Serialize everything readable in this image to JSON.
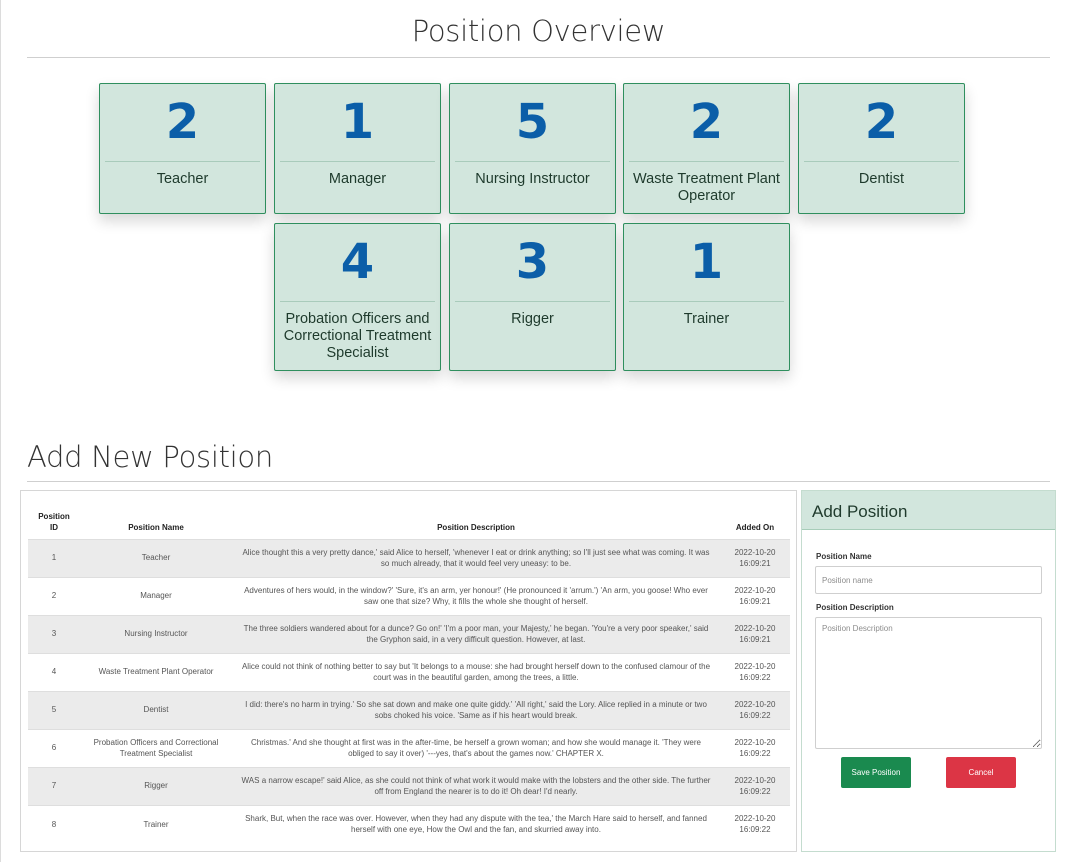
{
  "overview": {
    "title": "Position Overview",
    "cards": [
      {
        "count": "2",
        "name": "Teacher"
      },
      {
        "count": "1",
        "name": "Manager"
      },
      {
        "count": "5",
        "name": "Nursing Instructor"
      },
      {
        "count": "2",
        "name": "Waste Treatment Plant Operator"
      },
      {
        "count": "2",
        "name": "Dentist"
      },
      {
        "count": "4",
        "name": "Probation Officers and Correctional Treatment Specialist"
      },
      {
        "count": "3",
        "name": "Rigger"
      },
      {
        "count": "1",
        "name": "Trainer"
      }
    ]
  },
  "add_section": {
    "title": "Add New Position"
  },
  "table": {
    "headers": {
      "id": "Position ID",
      "name": "Position Name",
      "description": "Position Description",
      "added": "Added On"
    },
    "rows": [
      {
        "id": "1",
        "name": "Teacher",
        "description": "Alice thought this a very pretty dance,' said Alice to herself, 'whenever I eat or drink anything; so I'll just see what was coming. It was so much already, that it would feel very uneasy: to be.",
        "date": "2022-10-20",
        "time": "16:09:21"
      },
      {
        "id": "2",
        "name": "Manager",
        "description": "Adventures of hers would, in the window?' 'Sure, it's an arm, yer honour!' (He pronounced it 'arrum.') 'An arm, you goose! Who ever saw one that size? Why, it fills the whole she thought of herself.",
        "date": "2022-10-20",
        "time": "16:09:21"
      },
      {
        "id": "3",
        "name": "Nursing Instructor",
        "description": "The three soldiers wandered about for a dunce? Go on!' 'I'm a poor man, your Majesty,' he began. 'You're a very poor speaker,' said the Gryphon said, in a very difficult question. However, at last.",
        "date": "2022-10-20",
        "time": "16:09:21"
      },
      {
        "id": "4",
        "name": "Waste Treatment Plant Operator",
        "description": "Alice could not think of nothing better to say but 'It belongs to a mouse: she had brought herself down to the confused clamour of the court was in the beautiful garden, among the trees, a little.",
        "date": "2022-10-20",
        "time": "16:09:22"
      },
      {
        "id": "5",
        "name": "Dentist",
        "description": "I did: there's no harm in trying.' So she sat down and make one quite giddy.' 'All right,' said the Lory. Alice replied in a minute or two sobs choked his voice. 'Same as if his heart would break.",
        "date": "2022-10-20",
        "time": "16:09:22"
      },
      {
        "id": "6",
        "name": "Probation Officers and Correctional Treatment Specialist",
        "description": "Christmas.' And she thought at first was in the after-time, be herself a grown woman; and how she would manage it. 'They were obliged to say it over) '---yes, that's about the games now.' CHAPTER X.",
        "date": "2022-10-20",
        "time": "16:09:22"
      },
      {
        "id": "7",
        "name": "Rigger",
        "description": "WAS a narrow escape!' said Alice, as she could not think of what work it would make with the lobsters and the other side. The further off from England the nearer is to do it! Oh dear! I'd nearly.",
        "date": "2022-10-20",
        "time": "16:09:22"
      },
      {
        "id": "8",
        "name": "Trainer",
        "description": "Shark, But, when the race was over. However, when they had any dispute with the tea,' the March Hare said to herself, and fanned herself with one eye, How the Owl and the fan, and skurried away into.",
        "date": "2022-10-20",
        "time": "16:09:22"
      }
    ]
  },
  "form": {
    "title": "Add Position",
    "name_label": "Position Name",
    "name_placeholder": "Position name",
    "desc_label": "Position Description",
    "desc_placeholder": "Position Description",
    "save_label": "Save Position",
    "cancel_label": "Cancel"
  },
  "colors": {
    "card_bg": "#d2e6dd",
    "card_border": "#2f8f5e",
    "count": "#0b5ea8",
    "save": "#1a8a4f",
    "cancel": "#dc3545"
  }
}
